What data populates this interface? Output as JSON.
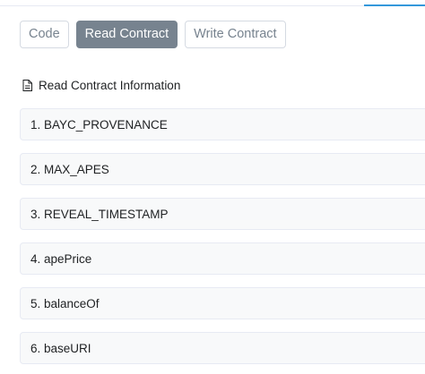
{
  "tabs": [
    {
      "label": "Code",
      "active": false
    },
    {
      "label": "Read Contract",
      "active": true
    },
    {
      "label": "Write Contract",
      "active": false
    }
  ],
  "section": {
    "icon": "document-icon",
    "title": "Read Contract Information"
  },
  "functions": [
    {
      "label": "1. BAYC_PROVENANCE"
    },
    {
      "label": "2. MAX_APES"
    },
    {
      "label": "3. REVEAL_TIMESTAMP"
    },
    {
      "label": "4. apePrice"
    },
    {
      "label": "5. balanceOf"
    },
    {
      "label": "6. baseURI"
    }
  ],
  "colors": {
    "active_tab_bg": "#77838f",
    "accent": "#3498db",
    "row_bg": "#f8f9fa"
  }
}
